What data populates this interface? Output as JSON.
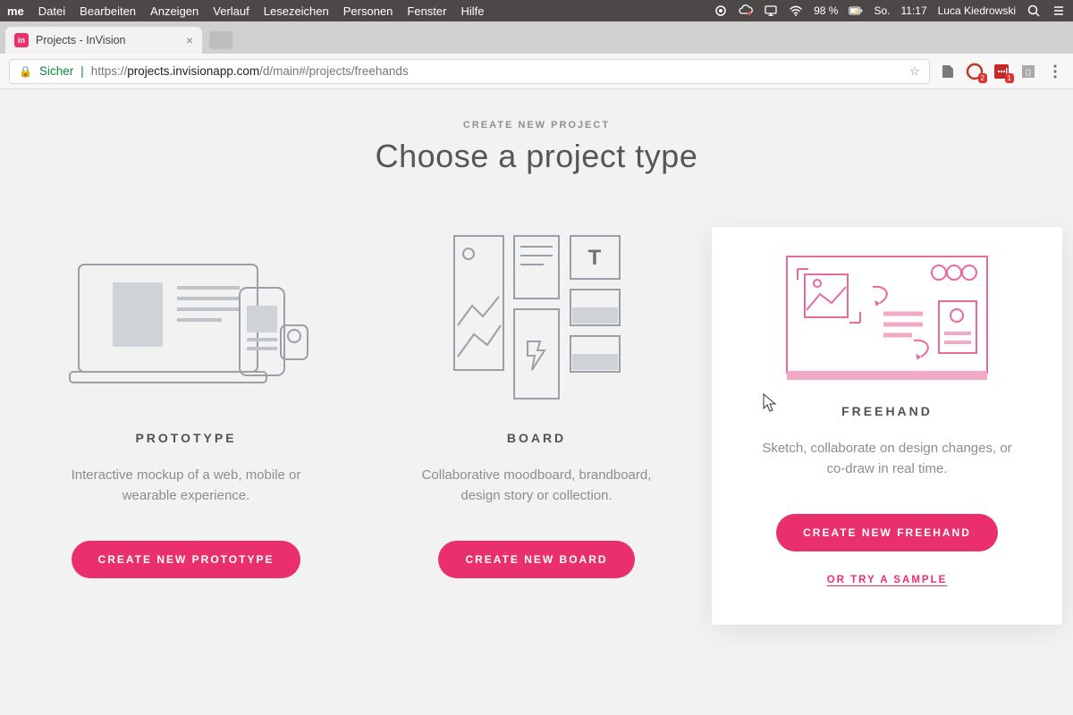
{
  "menubar": {
    "app_truncated": "me",
    "items": [
      "Datei",
      "Bearbeiten",
      "Anzeigen",
      "Verlauf",
      "Lesezeichen",
      "Personen",
      "Fenster",
      "Hilfe"
    ],
    "battery": "98 %",
    "charging_glyph": "⚡",
    "day": "So.",
    "time": "11:17",
    "user": "Luca Kiedrowski"
  },
  "browser": {
    "tab_title": "Projects - InVision",
    "favicon_text": "in",
    "secure_label": "Sicher",
    "url_scheme": "https://",
    "url_host": "projects.invisionapp.com",
    "url_path": "/d/main#/projects/freehands",
    "ext_badges": {
      "grammarly": "2",
      "lastpass": "1"
    }
  },
  "page": {
    "eyebrow": "CREATE NEW PROJECT",
    "title": "Choose a project type",
    "cards": [
      {
        "key": "prototype",
        "title": "PROTOTYPE",
        "desc": "Interactive mockup of a web, mobile or wearable experience.",
        "cta": "CREATE NEW PROTOTYPE"
      },
      {
        "key": "board",
        "title": "BOARD",
        "desc": "Collaborative moodboard, brandboard, design story or collection.",
        "cta": "CREATE NEW BOARD"
      },
      {
        "key": "freehand",
        "title": "FREEHAND",
        "desc": "Sketch, collaborate on design changes, or co-draw in real time.",
        "cta": "CREATE NEW FREEHAND",
        "sample": "OR TRY A SAMPLE"
      }
    ]
  }
}
